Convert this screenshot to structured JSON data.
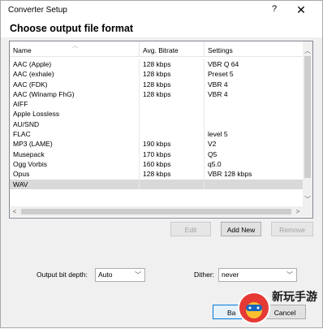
{
  "window": {
    "title": "Converter Setup",
    "help_glyph": "?",
    "close_glyph": "✕"
  },
  "heading": "Choose output file format",
  "list": {
    "columns": [
      "Name",
      "Avg. Bitrate",
      "Settings"
    ],
    "rows": [
      {
        "name": "AAC (Apple)",
        "bitrate": "128 kbps",
        "settings": "VBR Q 64"
      },
      {
        "name": "AAC (exhale)",
        "bitrate": "128 kbps",
        "settings": "Preset 5"
      },
      {
        "name": "AAC (FDK)",
        "bitrate": "128 kbps",
        "settings": "VBR 4"
      },
      {
        "name": "AAC (Winamp FhG)",
        "bitrate": "128 kbps",
        "settings": "VBR 4"
      },
      {
        "name": "AIFF",
        "bitrate": "",
        "settings": ""
      },
      {
        "name": "Apple Lossless",
        "bitrate": "",
        "settings": ""
      },
      {
        "name": "AU/SND",
        "bitrate": "",
        "settings": ""
      },
      {
        "name": "FLAC",
        "bitrate": "",
        "settings": "level 5"
      },
      {
        "name": "MP3 (LAME)",
        "bitrate": "190 kbps",
        "settings": "V2"
      },
      {
        "name": "Musepack",
        "bitrate": "170 kbps",
        "settings": "Q5"
      },
      {
        "name": "Ogg Vorbis",
        "bitrate": "160 kbps",
        "settings": "q5.0"
      },
      {
        "name": "Opus",
        "bitrate": "128 kbps",
        "settings": "VBR 128 kbps"
      },
      {
        "name": "WAV",
        "bitrate": "",
        "settings": "",
        "selected": true
      }
    ]
  },
  "buttons": {
    "edit": "Edit",
    "add_new": "Add New",
    "remove": "Remove",
    "back": "Ba",
    "cancel": "Cancel"
  },
  "options": {
    "bit_depth_label": "Output bit depth:",
    "bit_depth_value": "Auto",
    "dither_label": "Dither:",
    "dither_value": "never"
  },
  "watermark": {
    "text": "新玩手游"
  },
  "colors": {
    "selected_row": "#d9d9d9",
    "default_button_border": "#0078d7"
  }
}
